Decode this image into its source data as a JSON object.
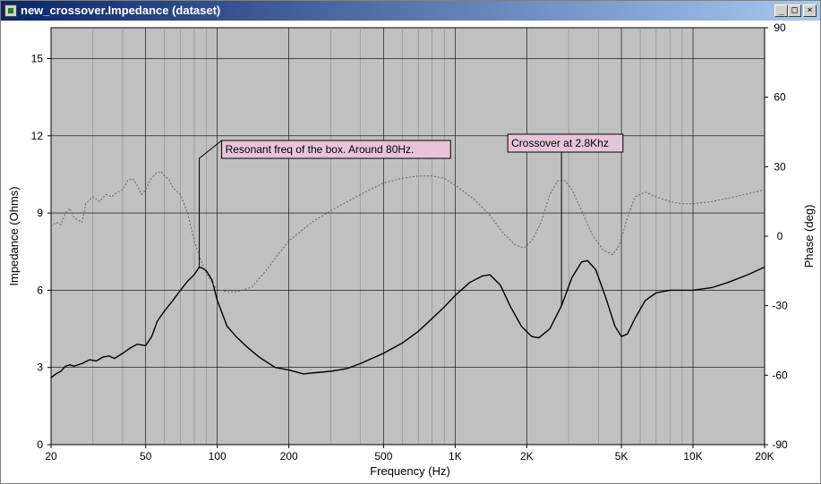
{
  "window": {
    "title": "new_crossover.Impedance (dataset)",
    "buttons": {
      "minimize": "_",
      "maximize": "□",
      "close": "×"
    }
  },
  "chart_data": {
    "type": "line",
    "xlabel": "Frequency (Hz)",
    "ylabel": "Impedance (Ohms)",
    "y2label": "Phase (deg)",
    "x_scale": "log",
    "xlim": [
      20,
      20000
    ],
    "ylim": [
      0,
      16.2
    ],
    "y2lim": [
      -90,
      90
    ],
    "x_ticks": [
      {
        "value": 20,
        "label": "20"
      },
      {
        "value": 50,
        "label": "50"
      },
      {
        "value": 100,
        "label": "100"
      },
      {
        "value": 200,
        "label": "200"
      },
      {
        "value": 500,
        "label": "500"
      },
      {
        "value": 1000,
        "label": "1K"
      },
      {
        "value": 2000,
        "label": "2K"
      },
      {
        "value": 5000,
        "label": "5K"
      },
      {
        "value": 10000,
        "label": "10K"
      },
      {
        "value": 20000,
        "label": "20K"
      }
    ],
    "x_minor": [
      30,
      40,
      60,
      70,
      80,
      90,
      300,
      400,
      600,
      700,
      800,
      900,
      3000,
      4000,
      6000,
      7000,
      8000,
      9000
    ],
    "y_ticks": [
      0,
      3,
      6,
      9,
      12,
      15
    ],
    "y2_ticks": [
      -90,
      -60,
      -30,
      0,
      30,
      60,
      90
    ],
    "grid": true,
    "series": [
      {
        "axis": "left",
        "style": "solid",
        "color": "#000000",
        "points": [
          [
            20,
            2.6
          ],
          [
            21,
            2.75
          ],
          [
            22,
            2.85
          ],
          [
            23,
            3.05
          ],
          [
            24,
            3.1
          ],
          [
            25,
            3.05
          ],
          [
            27,
            3.15
          ],
          [
            29,
            3.3
          ],
          [
            31,
            3.25
          ],
          [
            33,
            3.4
          ],
          [
            35,
            3.45
          ],
          [
            37,
            3.35
          ],
          [
            40,
            3.55
          ],
          [
            43,
            3.75
          ],
          [
            46,
            3.9
          ],
          [
            50,
            3.85
          ],
          [
            53,
            4.2
          ],
          [
            56,
            4.8
          ],
          [
            60,
            5.2
          ],
          [
            65,
            5.6
          ],
          [
            70,
            6.0
          ],
          [
            75,
            6.35
          ],
          [
            80,
            6.6
          ],
          [
            84,
            6.9
          ],
          [
            87,
            6.85
          ],
          [
            90,
            6.75
          ],
          [
            95,
            6.4
          ],
          [
            100,
            5.6
          ],
          [
            110,
            4.6
          ],
          [
            120,
            4.2
          ],
          [
            135,
            3.75
          ],
          [
            150,
            3.4
          ],
          [
            175,
            3.0
          ],
          [
            200,
            2.9
          ],
          [
            230,
            2.75
          ],
          [
            260,
            2.8
          ],
          [
            300,
            2.85
          ],
          [
            350,
            2.95
          ],
          [
            400,
            3.15
          ],
          [
            500,
            3.55
          ],
          [
            600,
            3.95
          ],
          [
            700,
            4.4
          ],
          [
            800,
            4.9
          ],
          [
            900,
            5.35
          ],
          [
            1000,
            5.8
          ],
          [
            1150,
            6.3
          ],
          [
            1300,
            6.55
          ],
          [
            1400,
            6.6
          ],
          [
            1550,
            6.2
          ],
          [
            1700,
            5.4
          ],
          [
            1900,
            4.6
          ],
          [
            2100,
            4.2
          ],
          [
            2250,
            4.15
          ],
          [
            2500,
            4.5
          ],
          [
            2800,
            5.4
          ],
          [
            3100,
            6.5
          ],
          [
            3400,
            7.1
          ],
          [
            3600,
            7.15
          ],
          [
            3900,
            6.8
          ],
          [
            4300,
            5.7
          ],
          [
            4700,
            4.6
          ],
          [
            5000,
            4.2
          ],
          [
            5300,
            4.3
          ],
          [
            5700,
            4.9
          ],
          [
            6300,
            5.6
          ],
          [
            7000,
            5.9
          ],
          [
            8000,
            6.0
          ],
          [
            10000,
            6.0
          ],
          [
            12000,
            6.1
          ],
          [
            14000,
            6.3
          ],
          [
            17000,
            6.6
          ],
          [
            20000,
            6.9
          ]
        ]
      },
      {
        "axis": "right",
        "style": "dotted",
        "color": "#666666",
        "points": [
          [
            20,
            4
          ],
          [
            21,
            6
          ],
          [
            22,
            5
          ],
          [
            23,
            10
          ],
          [
            24,
            12
          ],
          [
            25,
            8
          ],
          [
            27,
            6
          ],
          [
            28,
            14
          ],
          [
            30,
            17
          ],
          [
            32,
            15
          ],
          [
            34,
            18
          ],
          [
            36,
            17
          ],
          [
            38,
            19
          ],
          [
            40,
            20
          ],
          [
            42,
            24
          ],
          [
            44,
            25
          ],
          [
            46,
            22
          ],
          [
            48,
            18
          ],
          [
            50,
            20
          ],
          [
            52,
            24
          ],
          [
            55,
            27
          ],
          [
            58,
            28
          ],
          [
            60,
            26
          ],
          [
            63,
            24
          ],
          [
            65,
            21
          ],
          [
            70,
            18
          ],
          [
            75,
            10
          ],
          [
            80,
            -2
          ],
          [
            85,
            -10
          ],
          [
            90,
            -16
          ],
          [
            95,
            -20
          ],
          [
            100,
            -23
          ],
          [
            110,
            -24
          ],
          [
            120,
            -24
          ],
          [
            140,
            -22
          ],
          [
            160,
            -15
          ],
          [
            180,
            -8
          ],
          [
            200,
            -2
          ],
          [
            250,
            6
          ],
          [
            300,
            11
          ],
          [
            400,
            18
          ],
          [
            500,
            23
          ],
          [
            600,
            25
          ],
          [
            700,
            26
          ],
          [
            800,
            26
          ],
          [
            900,
            25
          ],
          [
            1000,
            22
          ],
          [
            1200,
            16
          ],
          [
            1400,
            9
          ],
          [
            1600,
            1
          ],
          [
            1800,
            -4
          ],
          [
            1950,
            -5
          ],
          [
            2100,
            -2
          ],
          [
            2300,
            6
          ],
          [
            2500,
            18
          ],
          [
            2700,
            24
          ],
          [
            2900,
            24
          ],
          [
            3100,
            20
          ],
          [
            3400,
            11
          ],
          [
            3800,
            0
          ],
          [
            4200,
            -6
          ],
          [
            4600,
            -8
          ],
          [
            4900,
            -4
          ],
          [
            5300,
            8
          ],
          [
            5700,
            17
          ],
          [
            6300,
            19
          ],
          [
            7000,
            17
          ],
          [
            8000,
            15
          ],
          [
            9000,
            14
          ],
          [
            10000,
            14
          ],
          [
            12000,
            15
          ],
          [
            15000,
            17
          ],
          [
            20000,
            20
          ]
        ]
      }
    ],
    "annotations": [
      {
        "text": "Resonant freq of the box.  Around 80Hz.",
        "x": 84,
        "y": 6.9
      },
      {
        "text": "Crossover at 2.8Khz",
        "x": 2800,
        "y": 5.4
      }
    ]
  }
}
